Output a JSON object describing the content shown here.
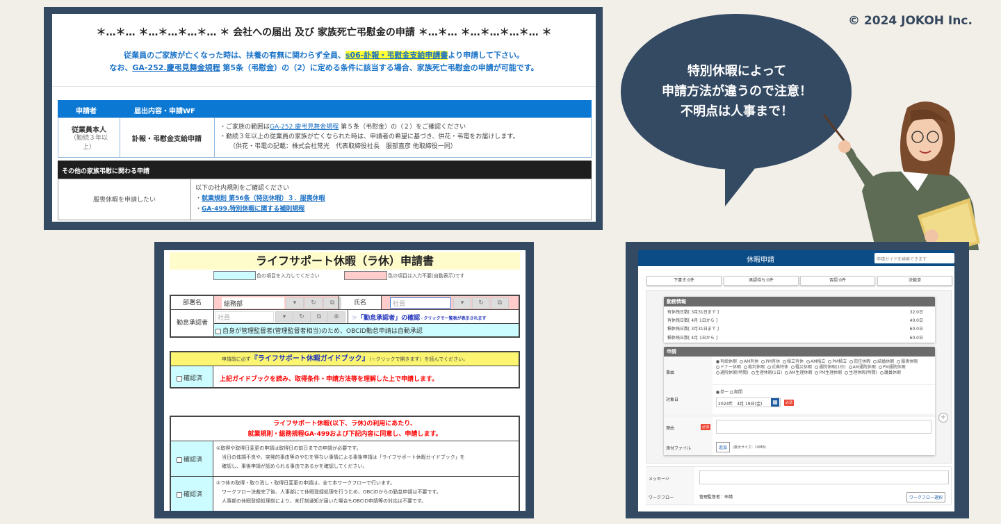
{
  "copyright": "© 2024 JOKOH Inc.",
  "bubble": {
    "lines": [
      "特別休暇によって",
      "申請方法が違うので注意！",
      "不明点は人事まで！"
    ]
  },
  "panel1": {
    "title": "＊…＊… ＊…＊…＊…＊… ＊ 会社への届出 及び 家族死亡弔慰金の申請 ＊…＊… ＊…＊…＊…＊… ＊",
    "line1_pre": "従業員のご家族が亡くなった時は、扶養の有無に関わらず全員、",
    "line1_link": "s06-訃報・弔慰金支給申請書",
    "line1_post": "より申請して下さい。",
    "line2_pre": "なお、",
    "line2_link": "GA-252.慶弔見舞金規程",
    "line2_post": " 第5条（弔慰金）の（2）に定める条件に該当する場合、家族死亡弔慰金の申請が可能です。",
    "table_headers": [
      "申請者",
      "届出内容・申請WF"
    ],
    "applicant": "従業員本人",
    "applicant_note": "（勤続３年以上）",
    "wf": "訃報・弔慰金支給申請",
    "detail1_pre": "・ご家族の範囲は",
    "detail1_link": "GA-252.慶弔見舞金規程",
    "detail1_post": " 第５条（弔慰金）の（２）をご確認ください",
    "detail2": "・勤続３年以上の従業員の家族が亡くなられた時は、申請者の希望に基づき、供花・弔電をお届けします。",
    "detail3": "（供花・弔電の記載：株式会社常光　代表取締役社長　服部直彦 他取締役一同）",
    "other_header": "その他の家族弔慰に関わる申請",
    "other_left": "服喪休暇を申請したい",
    "other_intro": "以下の社内規則をご確認ください",
    "other_links": [
      "就業規則 第56条（特別休暇）３．服喪休暇",
      "GA-499.特別休暇に関する補則規程"
    ]
  },
  "panel2": {
    "title": "ライフサポート休暇（ラ休）申請書",
    "legend_input": "色の項目を入力してください",
    "legend_auto": "色の項目は入力不要(自動表示)です",
    "dept_label": "部署名",
    "dept_value": "総務部",
    "name_label": "氏名",
    "name_placeholder": "社員",
    "approver_label": "勤怠承認者",
    "approver_placeholder": "社員",
    "approver_link": "☞「勤怠承認者」の確認",
    "approver_hint": "☜クリックで一覧表が表示されます",
    "self_approve": "自身が管理監督者(管理監督者相当)のため、OBCiD勤怠申請は自動承認",
    "guide_pre": "申請前に必ず",
    "guide_link": "『ライフサポート休暇ガイドブック』",
    "guide_post": "（☜クリックで開きます）を読んでください。",
    "confirm_label": "確認済",
    "guide_statement": "上記ガイドブックを読み、取得条件・申請方法等を理解した上で申請します。",
    "agree_line1": "ライフサポート休暇(以下、ラ休)の利用にあたり、",
    "agree_line2": "就業規則・総務規程GA-499および下記内容に同意し、申請します。",
    "items": [
      {
        "lines": [
          "①取得や取得日変更の申請は取得日の前日までの申請が必要です。",
          "当日の体調不良や、突発的事由等のやむを得ない事情による事後申請は「ライフサポート休暇ガイドブック」を",
          "確認し、事後申請が認められる事由であるかを確認してください。"
        ]
      },
      {
        "lines": [
          "②ラ休の取得・取り消し・取得日変更の申請は、全て本ワークフローで行います。",
          "ワークフロー決裁完了後、人事部にて休暇登録処理を行うため、OBCiDからの勤怠申請は不要です。",
          "人事部の休暇登録処理前により、未打刻通知が届いた場合もOBCiD申請等の対応は不要です。"
        ]
      }
    ]
  },
  "panel3": {
    "title": "休暇申請",
    "search_placeholder": "申請ガイドを検索できます",
    "tabs": [
      "下書き:0件",
      "承認待ち:0件",
      "否認:0件",
      "決裁済"
    ],
    "info_header": "勤務情報",
    "info_rows": [
      {
        "label": "有休残日数[ 3月31日まで ]",
        "value": "32.0日"
      },
      {
        "label": "有休残日数[ 4月 1日から ]",
        "value": "40.0日"
      },
      {
        "label": "積休残日数[ 3月31日まで ]",
        "value": "60.0日"
      },
      {
        "label": "積休残日数[ 4月 1日から ]",
        "value": "60.0日"
      }
    ],
    "apply_header": "申請",
    "reason_type_label": "事由",
    "reason_types": [
      "有給休暇",
      "AM有休",
      "PM有休",
      "積立有休",
      "AM積立",
      "PM積立",
      "慰任休暇",
      "結婚休暇",
      "服喪休暇",
      "ドナー休暇",
      "裁判休暇",
      "式典特休",
      "罹災休暇",
      "通院休暇(1日)",
      "AM通院休暇",
      "PM通院休暇",
      "通院休暇(時間)",
      "生理休暇(1日)",
      "AM生理休暇",
      "PM生理休暇",
      "生理休暇(時間)",
      "議員休暇"
    ],
    "date_label": "対象日",
    "date_modes": [
      "単一",
      "期間"
    ],
    "date_value": "2024年　4月 19日(金)",
    "required": "必須",
    "reason_label": "理由",
    "attach_label": "添付ファイル",
    "attach_button": "追加",
    "attach_note": "(最大サイズ：10MB)",
    "message_label": "メッセージ",
    "workflow_label": "ワークフロー",
    "workflow_value": "管理監督者：申請",
    "workflow_button": "ワークフロー選択"
  }
}
